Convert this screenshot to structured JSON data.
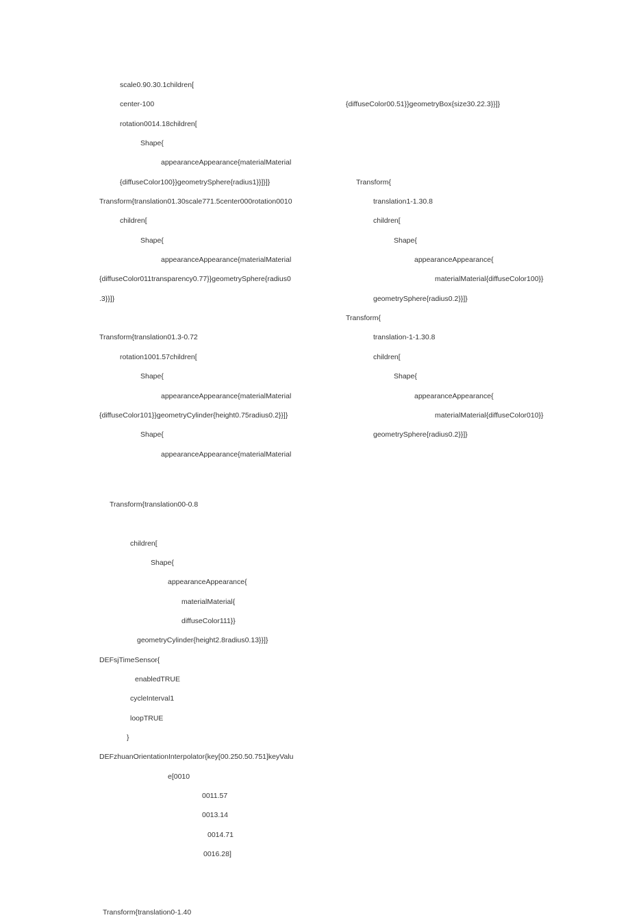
{
  "left": {
    "l1": "scale0.90.30.1children[",
    "l2": "center-100",
    "l3": "rotation0014.18children[",
    "l4": "Shape{",
    "l5": "appearanceAppearance{materialMaterial",
    "l6": "{diffuseColor100}}geometrySphere{radius1}}]}]}",
    "l7": "Transform{translation01.30scale771.5center000rotation0010",
    "l8": "children[",
    "l9": "Shape{",
    "l10": "appearanceAppearance{materialMaterial",
    "l11": "{diffuseColor011transparency0.77}}geometrySphere{radius0",
    "l12": ".3}}]}",
    "l14": "Transform{translation01.3-0.72",
    "l15": "rotation1001.57children[",
    "l16": "Shape{",
    "l17": "appearanceAppearance{materialMaterial",
    "l18": "{diffuseColor101}}geometryCylinder{height0.75radius0.2}}]}",
    "l19": "Shape{",
    "l20": "appearanceAppearance{materialMaterial"
  },
  "right": {
    "r1": "{diffuseColor00.51}}geometryBox{size30.22.3}}]}",
    "r4": "Transform{",
    "r5": "translation1-1.30.8",
    "r6": "children[",
    "r7": "Shape{",
    "r8": "appearanceAppearance{",
    "r9": "materialMaterial{diffuseColor100}}",
    "r10": "geometrySphere{radius0.2}}]}",
    "r11": "Transform{",
    "r12": "translation-1-1.30.8",
    "r13": "children[",
    "r14": "Shape{",
    "r15": "appearanceAppearance{",
    "r16": "materialMaterial{diffuseColor010}}",
    "r17": "geometrySphere{radius0.2}}]}"
  },
  "bottom": {
    "b1": "Transform{translation00-0.8",
    "b3": "children[",
    "b4": "Shape{",
    "b5": "appearanceAppearance{",
    "b6": "materialMaterial{",
    "b7": "diffuseColor111}}",
    "b8": "geometryCylinder{height2.8radius0.13}}]}",
    "b9": "DEFsjTimeSensor{",
    "b10": "enabledTRUE",
    "b11": "cycleInterval1",
    "b12": "loopTRUE",
    "b13": "}",
    "b14": "DEFzhuanOrientationInterpolator{key[00.250.50.751]keyValu",
    "b15": "e[0010",
    "b16": "0011.57",
    "b17": "0013.14",
    "b18": "0014.71",
    "b19": "0016.28]",
    "b21": "Transform{translation0-1.40"
  }
}
